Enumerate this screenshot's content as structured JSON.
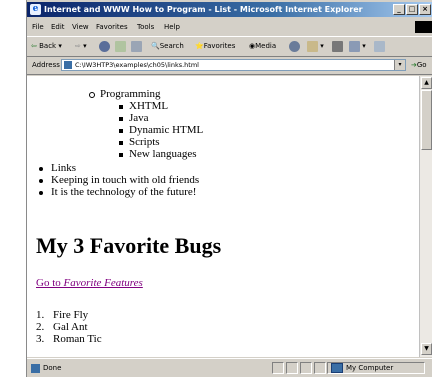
{
  "window": {
    "title": "Internet and WWW How to Program - List - Microsoft Internet Explorer"
  },
  "menu": [
    "File",
    "Edit",
    "View",
    "Favorites",
    "Tools",
    "Help"
  ],
  "toolbar": {
    "back": "Back",
    "search": "Search",
    "favorites": "Favorites",
    "media": "Media"
  },
  "address": {
    "label": "Address",
    "value": "C:\\IW3HTP3\\examples\\ch05\\links.html",
    "go": "Go"
  },
  "page": {
    "programming": "Programming",
    "programming_items": [
      "XHTML",
      "Java",
      "Dynamic HTML",
      "Scripts",
      "New languages"
    ],
    "top_items": [
      "Links",
      "Keeping in touch with old friends",
      "It is the technology of the future!"
    ],
    "heading": "My 3 Favorite Bugs",
    "link_prefix": "Go to ",
    "link_emph": "Favorite Features",
    "bugs": [
      "Fire Fly",
      "Gal Ant",
      "Roman Tic"
    ]
  },
  "status": {
    "done": "Done",
    "zone": "My Computer"
  }
}
